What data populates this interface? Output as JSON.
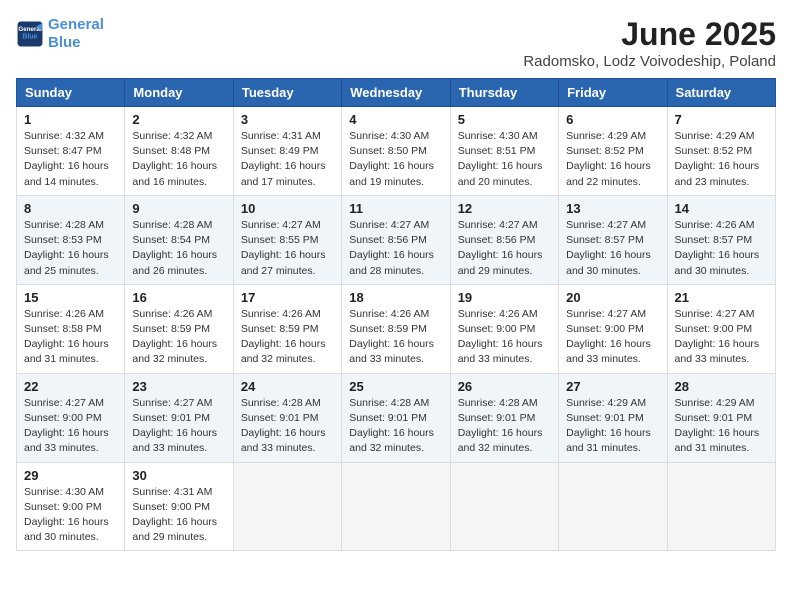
{
  "header": {
    "logo_line1": "General",
    "logo_line2": "Blue",
    "month": "June 2025",
    "location": "Radomsko, Lodz Voivodeship, Poland"
  },
  "weekdays": [
    "Sunday",
    "Monday",
    "Tuesday",
    "Wednesday",
    "Thursday",
    "Friday",
    "Saturday"
  ],
  "weeks": [
    [
      {
        "day": "1",
        "sunrise": "4:32 AM",
        "sunset": "8:47 PM",
        "daylight": "16 hours and 14 minutes."
      },
      {
        "day": "2",
        "sunrise": "4:32 AM",
        "sunset": "8:48 PM",
        "daylight": "16 hours and 16 minutes."
      },
      {
        "day": "3",
        "sunrise": "4:31 AM",
        "sunset": "8:49 PM",
        "daylight": "16 hours and 17 minutes."
      },
      {
        "day": "4",
        "sunrise": "4:30 AM",
        "sunset": "8:50 PM",
        "daylight": "16 hours and 19 minutes."
      },
      {
        "day": "5",
        "sunrise": "4:30 AM",
        "sunset": "8:51 PM",
        "daylight": "16 hours and 20 minutes."
      },
      {
        "day": "6",
        "sunrise": "4:29 AM",
        "sunset": "8:52 PM",
        "daylight": "16 hours and 22 minutes."
      },
      {
        "day": "7",
        "sunrise": "4:29 AM",
        "sunset": "8:52 PM",
        "daylight": "16 hours and 23 minutes."
      }
    ],
    [
      {
        "day": "8",
        "sunrise": "4:28 AM",
        "sunset": "8:53 PM",
        "daylight": "16 hours and 25 minutes."
      },
      {
        "day": "9",
        "sunrise": "4:28 AM",
        "sunset": "8:54 PM",
        "daylight": "16 hours and 26 minutes."
      },
      {
        "day": "10",
        "sunrise": "4:27 AM",
        "sunset": "8:55 PM",
        "daylight": "16 hours and 27 minutes."
      },
      {
        "day": "11",
        "sunrise": "4:27 AM",
        "sunset": "8:56 PM",
        "daylight": "16 hours and 28 minutes."
      },
      {
        "day": "12",
        "sunrise": "4:27 AM",
        "sunset": "8:56 PM",
        "daylight": "16 hours and 29 minutes."
      },
      {
        "day": "13",
        "sunrise": "4:27 AM",
        "sunset": "8:57 PM",
        "daylight": "16 hours and 30 minutes."
      },
      {
        "day": "14",
        "sunrise": "4:26 AM",
        "sunset": "8:57 PM",
        "daylight": "16 hours and 30 minutes."
      }
    ],
    [
      {
        "day": "15",
        "sunrise": "4:26 AM",
        "sunset": "8:58 PM",
        "daylight": "16 hours and 31 minutes."
      },
      {
        "day": "16",
        "sunrise": "4:26 AM",
        "sunset": "8:59 PM",
        "daylight": "16 hours and 32 minutes."
      },
      {
        "day": "17",
        "sunrise": "4:26 AM",
        "sunset": "8:59 PM",
        "daylight": "16 hours and 32 minutes."
      },
      {
        "day": "18",
        "sunrise": "4:26 AM",
        "sunset": "8:59 PM",
        "daylight": "16 hours and 33 minutes."
      },
      {
        "day": "19",
        "sunrise": "4:26 AM",
        "sunset": "9:00 PM",
        "daylight": "16 hours and 33 minutes."
      },
      {
        "day": "20",
        "sunrise": "4:27 AM",
        "sunset": "9:00 PM",
        "daylight": "16 hours and 33 minutes."
      },
      {
        "day": "21",
        "sunrise": "4:27 AM",
        "sunset": "9:00 PM",
        "daylight": "16 hours and 33 minutes."
      }
    ],
    [
      {
        "day": "22",
        "sunrise": "4:27 AM",
        "sunset": "9:00 PM",
        "daylight": "16 hours and 33 minutes."
      },
      {
        "day": "23",
        "sunrise": "4:27 AM",
        "sunset": "9:01 PM",
        "daylight": "16 hours and 33 minutes."
      },
      {
        "day": "24",
        "sunrise": "4:28 AM",
        "sunset": "9:01 PM",
        "daylight": "16 hours and 33 minutes."
      },
      {
        "day": "25",
        "sunrise": "4:28 AM",
        "sunset": "9:01 PM",
        "daylight": "16 hours and 32 minutes."
      },
      {
        "day": "26",
        "sunrise": "4:28 AM",
        "sunset": "9:01 PM",
        "daylight": "16 hours and 32 minutes."
      },
      {
        "day": "27",
        "sunrise": "4:29 AM",
        "sunset": "9:01 PM",
        "daylight": "16 hours and 31 minutes."
      },
      {
        "day": "28",
        "sunrise": "4:29 AM",
        "sunset": "9:01 PM",
        "daylight": "16 hours and 31 minutes."
      }
    ],
    [
      {
        "day": "29",
        "sunrise": "4:30 AM",
        "sunset": "9:00 PM",
        "daylight": "16 hours and 30 minutes."
      },
      {
        "day": "30",
        "sunrise": "4:31 AM",
        "sunset": "9:00 PM",
        "daylight": "16 hours and 29 minutes."
      },
      null,
      null,
      null,
      null,
      null
    ]
  ],
  "labels": {
    "sunrise": "Sunrise:",
    "sunset": "Sunset:",
    "daylight": "Daylight:"
  }
}
